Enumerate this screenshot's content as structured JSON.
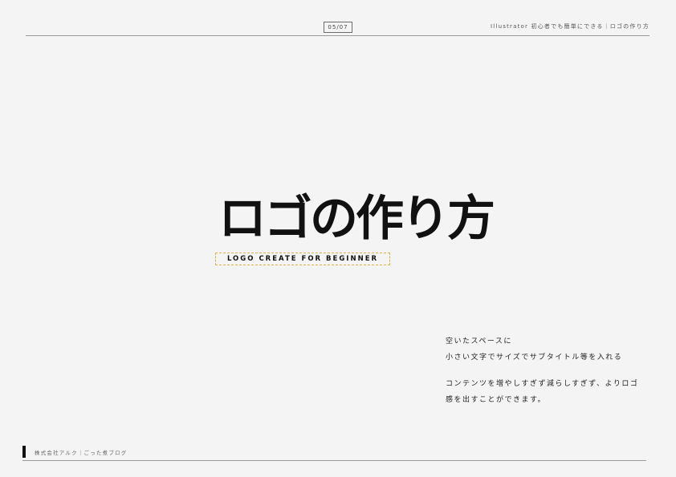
{
  "header": {
    "page_number": "05/07",
    "title": "Illustrator 初心者でも簡単にできる｜ロゴの作り方"
  },
  "logo": {
    "main_text": "ロゴの作り方",
    "subtitle": "LOGO CREATE FOR BEGINNER"
  },
  "body": {
    "paragraphs": [
      {
        "line1": "空いたスペースに",
        "line2": "小さい文字でサイズでサブタイトル等を入れる"
      },
      {
        "line1": "コンテンツを増やしすぎず減らしすぎず、よりロゴ",
        "line2": "感を出すことができます。"
      }
    ]
  },
  "footer": {
    "text": "株式会社アルク｜ごった煮ブログ"
  },
  "colors": {
    "background": "#f4f4f4",
    "text": "#1a1a1a",
    "subtitle_border": "#d9b24a",
    "rule": "#9a9a9a"
  }
}
